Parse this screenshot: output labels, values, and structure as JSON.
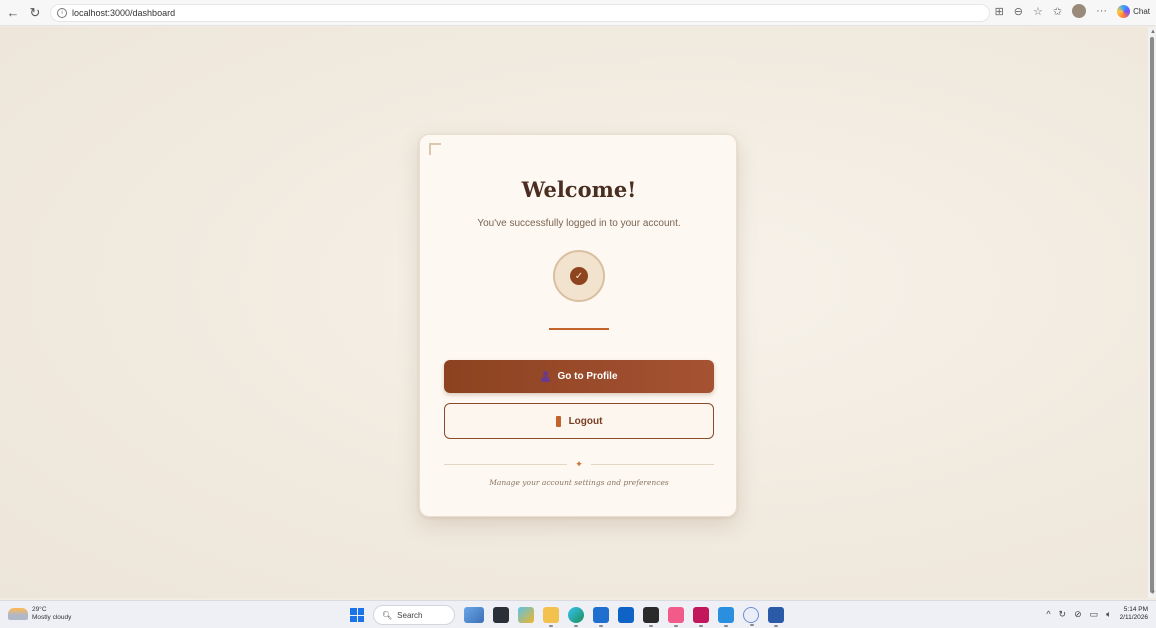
{
  "browser": {
    "url": "localhost:3000/dashboard",
    "chat_label": "Chat"
  },
  "card": {
    "title": "Welcome!",
    "subtitle": "You've successfully logged in to your account.",
    "primary_button": "Go to Profile",
    "secondary_button": "Logout",
    "footnote": "Manage your account settings and preferences"
  },
  "colors": {
    "accent": "#a55233",
    "primary_dark": "#8c4220",
    "title": "#4a2e22",
    "background": "#f1ebe2"
  },
  "taskbar": {
    "weather_temp": "29°C",
    "weather_desc": "Mostly cloudy",
    "search_label": "Search",
    "time": "5:14 PM",
    "date": "2/11/2026"
  }
}
